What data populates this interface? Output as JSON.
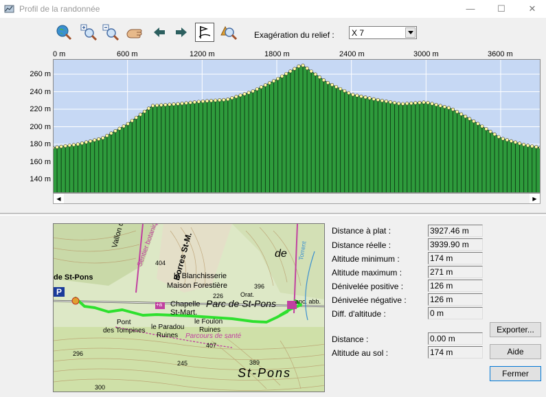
{
  "window": {
    "title": "Profil de la randonnée",
    "minimize": "—",
    "maximize": "☐",
    "close": "✕"
  },
  "toolbar": {
    "relief_label": "Exagération du relief :",
    "relief_value": "X 7"
  },
  "profile": {
    "x_ticks": [
      "0 m",
      "600 m",
      "1200 m",
      "1800 m",
      "2400 m",
      "3000 m",
      "3600 m"
    ],
    "y_ticks": [
      "260 m",
      "240 m",
      "220 m",
      "200 m",
      "180 m",
      "160 m",
      "140 m"
    ],
    "distances_m": [
      0,
      200,
      400,
      600,
      800,
      1000,
      1200,
      1400,
      1600,
      1800,
      2000,
      2200,
      2400,
      2600,
      2800,
      3000,
      3200,
      3400,
      3600,
      3800,
      3927
    ],
    "altitudes_m": [
      176,
      180,
      187,
      203,
      224,
      226,
      229,
      231,
      240,
      254,
      271,
      251,
      237,
      231,
      226,
      228,
      221,
      205,
      187,
      179,
      176
    ],
    "colors": {
      "sky": "#c6d8f4",
      "fill": "#2e9b3c",
      "marker": "#fffca0"
    }
  },
  "stats": {
    "distance_plat_label": "Distance à plat :",
    "distance_plat_value": "3927.46 m",
    "distance_reelle_label": "Distance réelle :",
    "distance_reelle_value": "3939.90 m",
    "alt_min_label": "Altitude minimum :",
    "alt_min_value": "174 m",
    "alt_max_label": "Altitude maximum :",
    "alt_max_value": "271 m",
    "deniv_pos_label": "Dénivelée positive :",
    "deniv_pos_value": "126 m",
    "deniv_neg_label": "Dénivelée négative :",
    "deniv_neg_value": "126 m",
    "diff_alt_label": "Diff. d'altitude :",
    "diff_alt_value": "0 m",
    "distance_label": "Distance :",
    "distance_value": "0.00 m",
    "alt_sol_label": "Altitude au sol :",
    "alt_sol_value": "174 m"
  },
  "buttons": {
    "export": "Exporter...",
    "help": "Aide",
    "close": "Fermer"
  },
  "map_labels": {
    "vallon": "Vallon du G.",
    "sentier": "Sentier botanique",
    "borres": "Borres St-M.",
    "de": "de",
    "blanchisserie": "la Blanchisserie",
    "maison": "Maison Forestière",
    "chapelle": "Chapelle",
    "st_mart": "St-Mart.",
    "parc": "Parc de St-Pons",
    "pont": "Pont",
    "tompines": "des Tompines",
    "paradou": "le Paradou",
    "ruines1": "Ruines",
    "foulon": "le Foulon",
    "ruines2": "Ruines",
    "parcours": "Parcours de santé",
    "st_pons_big": "St-Pons",
    "de_st_pons": "de St-Pons",
    "torrent": "Torrent",
    "orat": "Orat.",
    "anc_abb": "anc. abb.",
    "n404": "404",
    "n396": "396",
    "n226": "226",
    "n407": "407",
    "n296": "296",
    "n245": "245",
    "n389": "389",
    "n300": "300",
    "parking": "P",
    "lift": "+a"
  }
}
